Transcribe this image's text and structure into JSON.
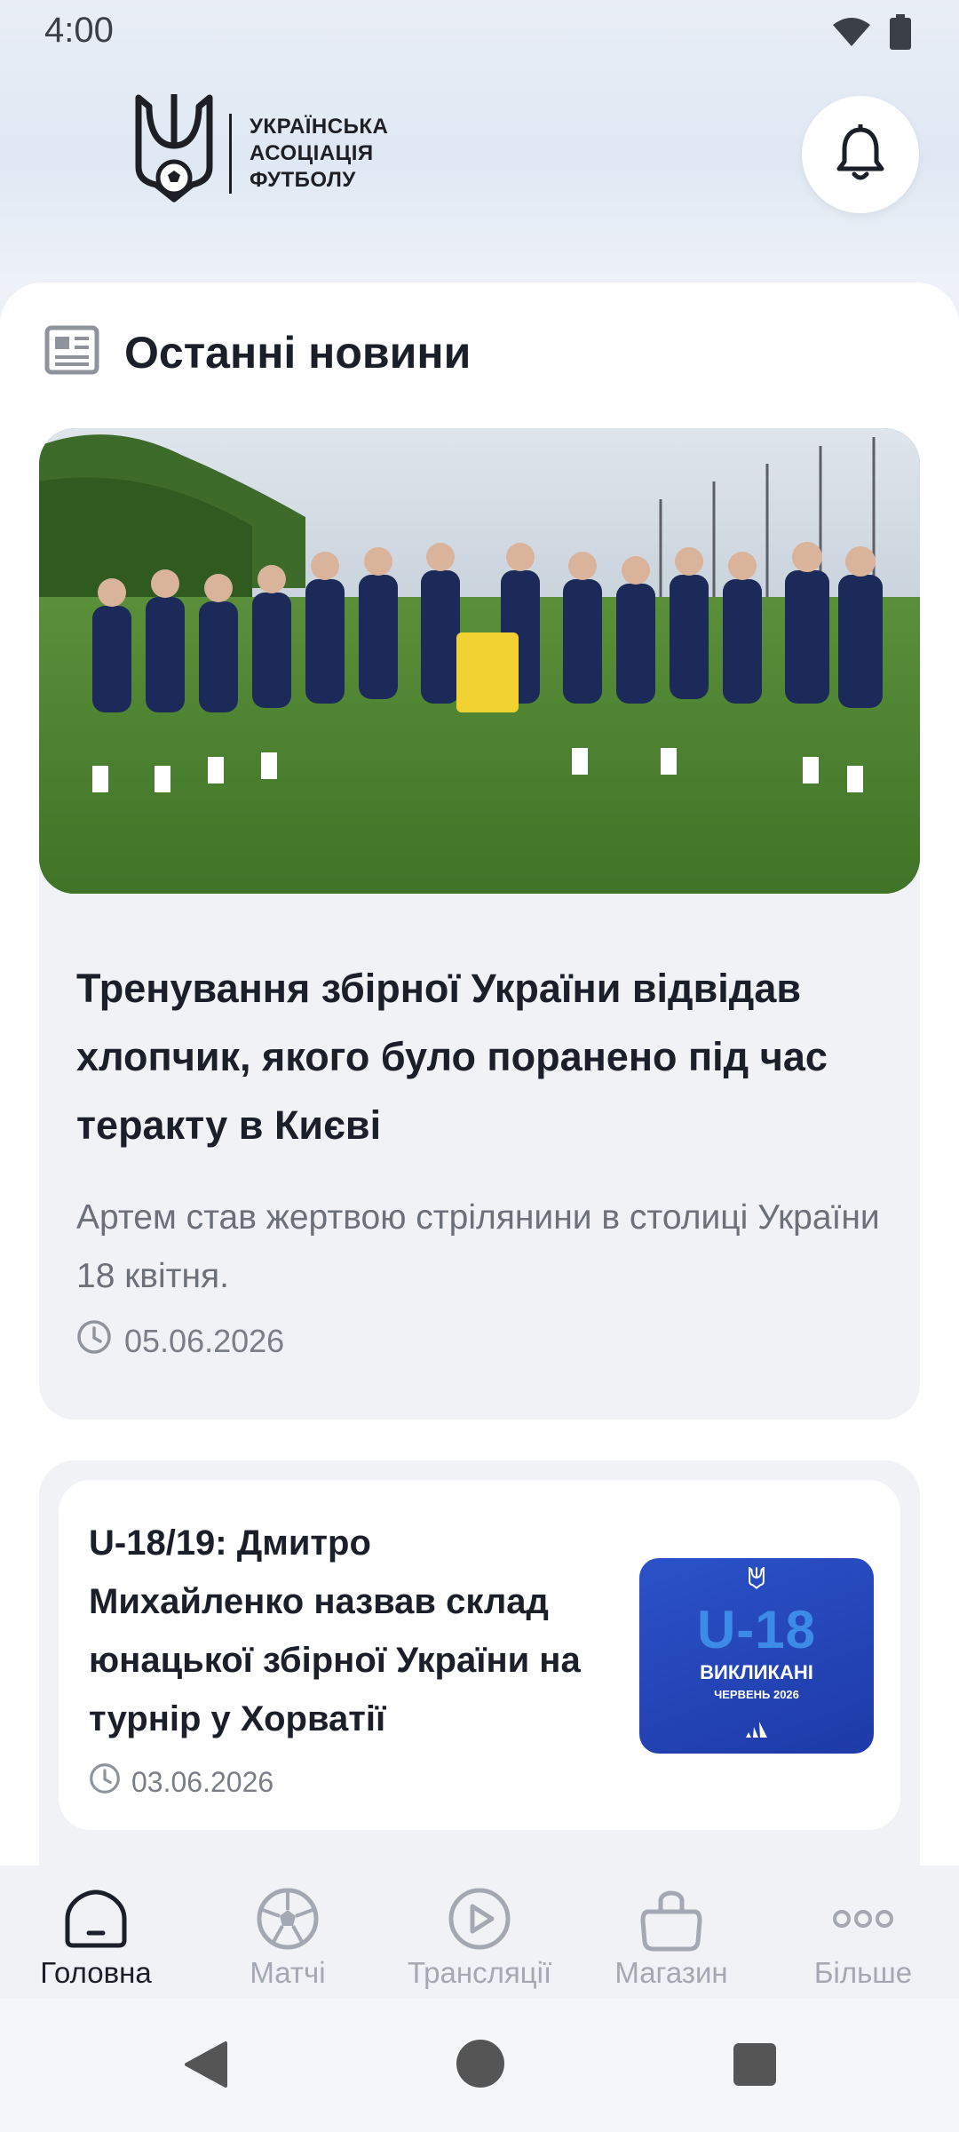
{
  "status_bar": {
    "time": "4:00",
    "icons": [
      "wifi-icon",
      "battery-icon"
    ]
  },
  "header": {
    "logo_lines": [
      "УКРАЇНСЬКА",
      "АСОЦІАЦІЯ",
      "ФУТБОЛУ"
    ],
    "bell_icon": "bell-icon"
  },
  "section": {
    "title": "Останні новини",
    "icon": "newspaper-icon"
  },
  "featured": {
    "image_alt": "team-photo",
    "title": "Тренування збірної України відвідав хлопчик, якого було поранено під час теракту в Києві",
    "description": "Артем став жертвою стрілянини в столиці України 18 квітня.",
    "date": "05.06.2026"
  },
  "news_item": {
    "title": "U-18/19: Дмитро Михайленко назвав склад юнацької збірної України на турнір у Хорватії",
    "date": "03.06.2026",
    "thumb": {
      "big": "U-18",
      "mid": "ВИКЛИКАНІ",
      "small": "ЧЕРВЕНЬ 2026"
    }
  },
  "bottom_nav": [
    {
      "label": "Головна",
      "icon": "home-icon",
      "active": true
    },
    {
      "label": "Матчі",
      "icon": "football-icon",
      "active": false
    },
    {
      "label": "Трансляції",
      "icon": "play-icon",
      "active": false
    },
    {
      "label": "Магазин",
      "icon": "shopping-bag-icon",
      "active": false
    },
    {
      "label": "Більше",
      "icon": "more-icon",
      "active": false
    }
  ],
  "colors": {
    "accent_blue": "#1e3aa8",
    "inactive": "#a3a8b2",
    "text": "#1b1f2a"
  }
}
